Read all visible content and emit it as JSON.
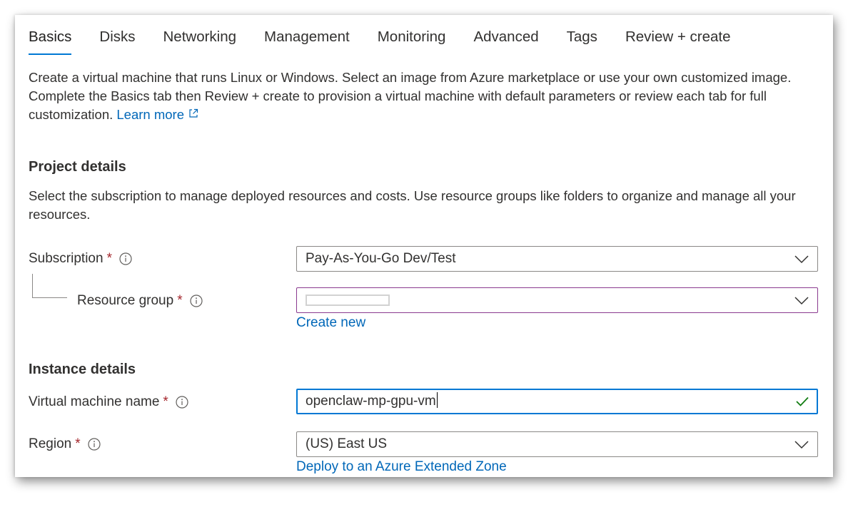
{
  "tabs": [
    {
      "label": "Basics",
      "active": true
    },
    {
      "label": "Disks",
      "active": false
    },
    {
      "label": "Networking",
      "active": false
    },
    {
      "label": "Management",
      "active": false
    },
    {
      "label": "Monitoring",
      "active": false
    },
    {
      "label": "Advanced",
      "active": false
    },
    {
      "label": "Tags",
      "active": false
    },
    {
      "label": "Review + create",
      "active": false
    }
  ],
  "intro": {
    "text": "Create a virtual machine that runs Linux or Windows. Select an image from Azure marketplace or use your own customized image. Complete the Basics tab then Review + create to provision a virtual machine with default parameters or review each tab for full customization. ",
    "learn_more": "Learn more"
  },
  "project": {
    "title": "Project details",
    "description": "Select the subscription to manage deployed resources and costs. Use resource groups like folders to organize and manage all your resources.",
    "subscription_label": "Subscription",
    "subscription_value": "Pay-As-You-Go Dev/Test",
    "resource_group_label": "Resource group",
    "resource_group_value": "",
    "create_new": "Create new"
  },
  "instance": {
    "title": "Instance details",
    "vm_name_label": "Virtual machine name",
    "vm_name_value": "openclaw-mp-gpu-vm",
    "region_label": "Region",
    "region_value": "(US) East US",
    "extended_zone_link": "Deploy to an Azure Extended Zone"
  },
  "required_marker": "*",
  "colors": {
    "accent": "#0078d4",
    "link": "#0067b8",
    "required": "#a4262c",
    "valid_check": "#107c10",
    "text": "#323130"
  },
  "icons": [
    "external-link-icon",
    "info-icon",
    "chevron-down-icon",
    "checkmark-icon"
  ]
}
